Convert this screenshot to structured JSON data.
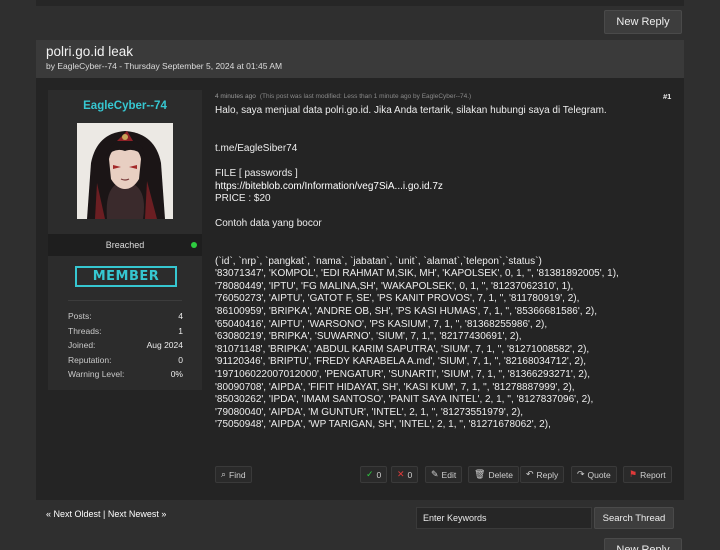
{
  "top_bar": {
    "new_reply_label": "New Reply"
  },
  "thread": {
    "title": "polri.go.id leak",
    "byline": "by EagleCyber--74 - Thursday September 5, 2024 at 01:45 AM"
  },
  "author": {
    "name": "EagleCyber--74",
    "status": "Breached",
    "rank": "MEMBER",
    "stats": [
      {
        "label": "Posts:",
        "value": "4"
      },
      {
        "label": "Threads:",
        "value": "1"
      },
      {
        "label": "Joined:",
        "value": "Aug 2024"
      },
      {
        "label": "Reputation:",
        "value": "0"
      },
      {
        "label": "Warning Level:",
        "value": "0%"
      }
    ],
    "colors": {
      "name": "#36c7d1",
      "online": "#2ecc40"
    }
  },
  "post": {
    "time": "4 minutes ago",
    "edit_note": "(This post was last modified: Less than 1 minute ago by EagleCyber--74.)",
    "number": "#1",
    "intro": "Halo, saya menjual data polri.go.id. Jika Anda tertarik, silakan hubungi saya di Telegram.",
    "telegram": "t.me/EagleSiber74",
    "file_label": "FILE [ passwords ]",
    "file_link": "https://biteblob.com/Information/veg7SiA...i.go.id.7z",
    "price": "PRICE : $20",
    "sample_heading": "Contoh data yang bocor",
    "sample_lines": [
      "(`id`, `nrp`, `pangkat`, `nama`, `jabatan`, `unit`, `alamat`,`telepon`,`status`)",
      "'83071347', 'KOMPOL', 'EDI RAHMAT M,SIK, MH', 'KAPOLSEK', 0, 1, '', '81381892005', 1),",
      "'78080449', 'IPTU', 'FG MALINA,SH', 'WAKAPOLSEK', 0, 1, '', '81237062310', 1),",
      "'76050273', 'AIPTU', 'GATOT F, SE', 'PS KANIT PROVOS', 7, 1, '', '811780919', 2),",
      "'86100959', 'BRIPKA', 'ANDRE OB, SH', 'PS KASI HUMAS', 7, 1, '', '85366681586', 2),",
      "'65040416', 'AIPTU', 'WARSONO', 'PS KASIUM', 7, 1, '', '81368255986', 2),",
      "'63080219', 'BRIPKA', 'SUWARNO', 'SIUM', 7, 1,'', '82177430691', 2),",
      "'81071148', 'BRIPKA', 'ABDUL KARIM SAPUTRA', 'SIUM', 7, 1, '', '81271008582', 2),",
      "'91120346', 'BRIPTU', 'FREDY KARABELA A.md', 'SIUM', 7, 1, '', '82168034712', 2),",
      "'197106022007012000', 'PENGATUR', 'SUNARTI', 'SIUM', 7, 1, '', '81366293271', 2),",
      "'80090708', 'AIPDA', 'FIFIT HIDAYAT, SH', 'KASI KUM', 7, 1, '', '81278887999', 2),",
      "'85030262', 'IPDA', 'IMAM SANTOSO', 'PANIT SAYA INTEL', 2, 1, '', '8127837096', 2),",
      "'79080040', 'AIPDA', 'M GUNTUR', 'INTEL', 2, 1, '', '81273551979', 2),",
      "'75050948', 'AIPDA', 'WP TARIGAN, SH', 'INTEL', 2, 1, '', '81271678062', 2),"
    ],
    "actions": {
      "find": "Find",
      "like_count": "0",
      "dislike_count": "0",
      "edit": "Edit",
      "delete": "Delete",
      "reply": "Reply",
      "quote": "Quote",
      "report": "Report"
    },
    "icon_colors": {
      "like": "#2ecc40",
      "dislike": "#e03a3a",
      "report": "#e03a3a"
    }
  },
  "footer": {
    "oldest": "« Next Oldest",
    "separator": "|",
    "newest": "Next Newest »",
    "search_placeholder": "Enter Keywords",
    "search_button": "Search Thread"
  },
  "bottom_bar": {
    "new_reply_label": "New Reply"
  }
}
